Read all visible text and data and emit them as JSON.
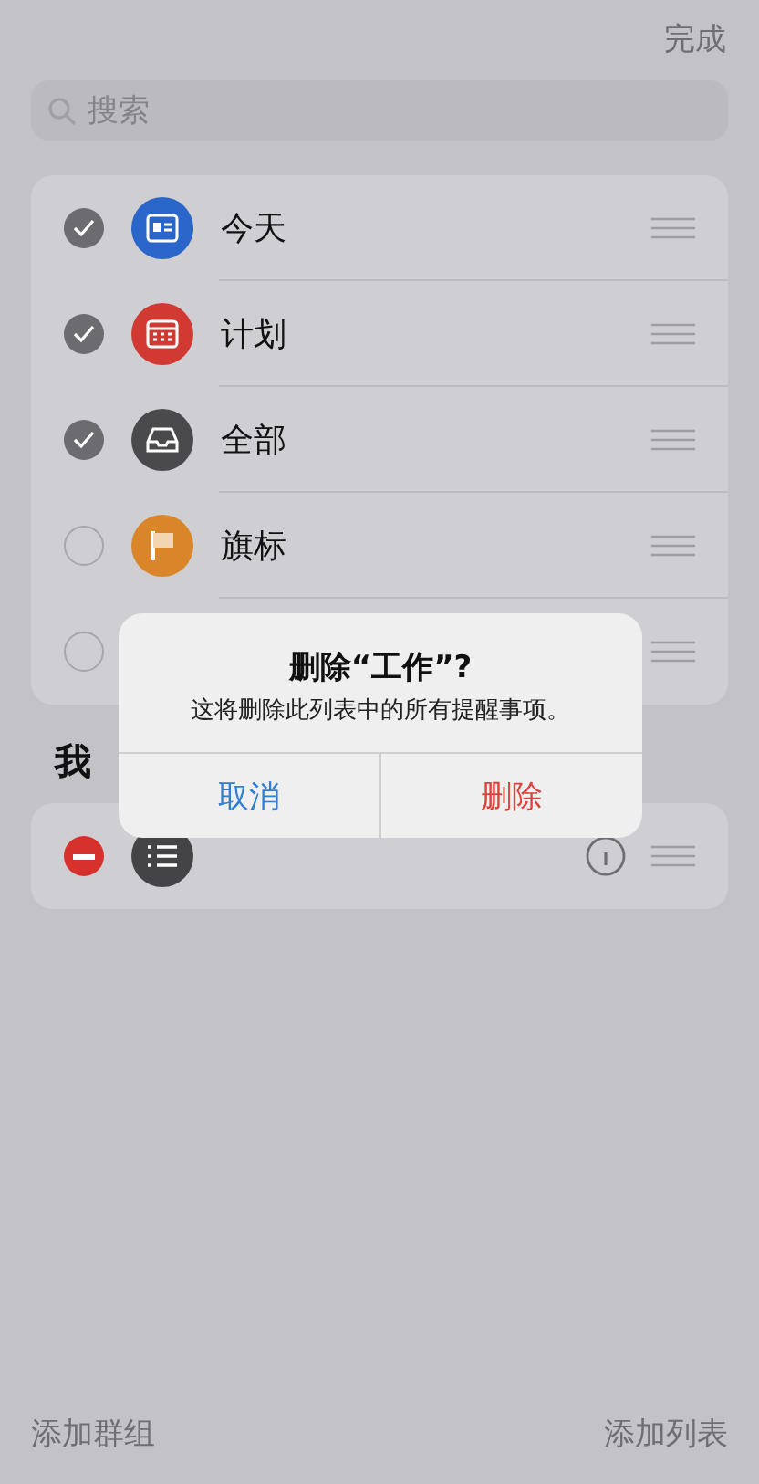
{
  "nav": {
    "done": "完成"
  },
  "search": {
    "placeholder": "搜索"
  },
  "smart_lists": [
    {
      "name": "今天",
      "checked": true,
      "kind": "today",
      "color": "#2a66c9"
    },
    {
      "name": "计划",
      "checked": true,
      "kind": "calendar",
      "color": "#d13a32"
    },
    {
      "name": "全部",
      "checked": true,
      "kind": "tray",
      "color": "#4a4a4c"
    },
    {
      "name": "旗标",
      "checked": false,
      "kind": "flag",
      "color": "#d9862a"
    },
    {
      "checked": false
    }
  ],
  "section_title": "我",
  "my_lists": [
    {
      "kind": "list",
      "color": "#444446"
    }
  ],
  "alert": {
    "title": "删除“工作”?",
    "message": "这将删除此列表中的所有提醒事项。",
    "buttons": [
      {
        "label": "取消",
        "kind": "cancel"
      },
      {
        "label": "删除",
        "kind": "destructive"
      }
    ]
  },
  "toolbar": {
    "left": "添加群组",
    "right": "添加列表"
  }
}
